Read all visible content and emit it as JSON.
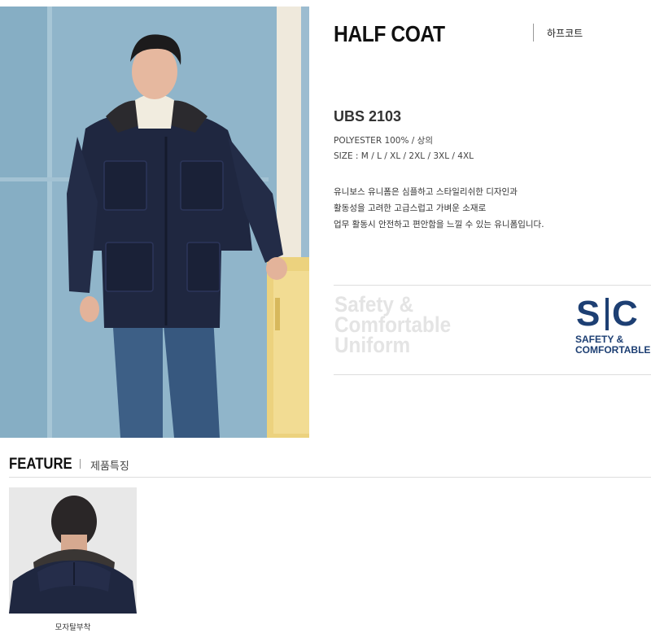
{
  "product": {
    "title": "HALF COAT",
    "title_ko": "하프코트",
    "model": "UBS 2103",
    "material": "POLYESTER 100% / 상의",
    "sizes": "SIZE : M / L / XL / 2XL / 3XL / 4XL",
    "description": [
      "유니보스 유니폼은 심플하고 스타일리쉬한 디자인과",
      "활동성을 고려한 고급스럽고 가벼운 소재로",
      "업무 활동시 안전하고 편안함을 느낄 수 있는 유니폼입니다."
    ]
  },
  "brand": {
    "slogan": [
      "Safety &",
      "Comfortable",
      "Uniform"
    ],
    "logo_s": "S",
    "logo_c": "C",
    "logo_sub": [
      "SAFETY &",
      "COMFORTABLE"
    ],
    "logo_color": "#1d3f73"
  },
  "feature": {
    "title": "FEATURE",
    "title_ko": "제품특징",
    "items": [
      {
        "caption": "모자탈부착"
      }
    ]
  },
  "colors": {
    "coat_navy": "#1f2740",
    "background_blue": "#8fb4c9",
    "slogan_gray": "#e4e4e4"
  }
}
